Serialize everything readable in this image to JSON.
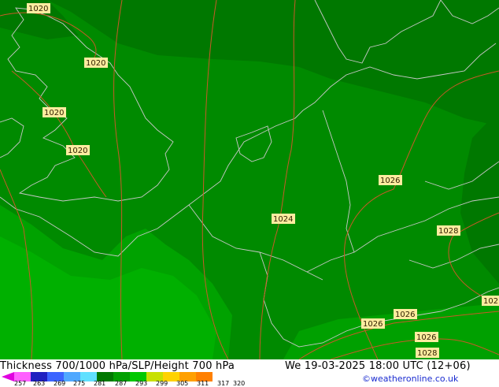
{
  "map": {
    "isobar_labels": [
      "1020",
      "1020",
      "1020",
      "1020",
      "1024",
      "1026",
      "1028",
      "1026",
      "1026",
      "1026",
      "1028",
      "102"
    ],
    "colors": {
      "background_dark": "#007a00",
      "background_mid": "#008c00",
      "background_light": "#00a400",
      "background_bright": "#00b400",
      "isobar": "#c85a28",
      "coastline": "#c8c8c8",
      "label_fill": "#ffeca0"
    }
  },
  "footer": {
    "title": "Thickness 700/1000 hPa/SLP/Height 700 hPa",
    "valid_time": "We 19-03-2025 18:00 UTC (12+06)",
    "credit": "©weatheronline.co.uk",
    "scale_ticks": [
      "257",
      "263",
      "269",
      "275",
      "281",
      "287",
      "293",
      "299",
      "305",
      "311",
      "317",
      "320"
    ],
    "scale_colors": [
      "#e000e0",
      "#ff60ff",
      "#2020c0",
      "#3c64ff",
      "#50a8ff",
      "#60e0ff",
      "#007800",
      "#00a000",
      "#00c800",
      "#c8e000",
      "#ffd200",
      "#ffa000",
      "#ff8000"
    ]
  }
}
